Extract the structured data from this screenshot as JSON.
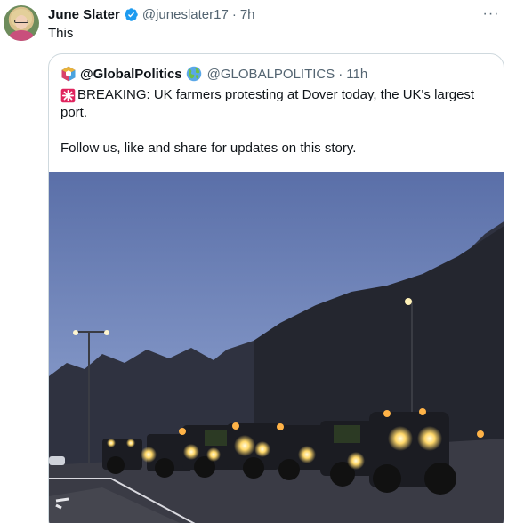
{
  "tweet": {
    "author_name": "June Slater",
    "handle": "@juneslater17",
    "separator": "·",
    "time": "7h",
    "text": "This",
    "more_label": "···"
  },
  "quote": {
    "author_name": "@GlobalPolitics",
    "handle": "@GLOBALPOLITICS",
    "separator": "·",
    "time": "11h",
    "breaking_text": "BREAKING: UK farmers protesting at Dover today, the UK's largest",
    "breaking_cont": "port.",
    "follow_text": "Follow us, like and share for updates on this story."
  },
  "colors": {
    "verified": "#1d9bf0",
    "muted": "#536471",
    "border": "#cfd9de",
    "siren": "#e0245e"
  },
  "icons": [
    "verified-badge-icon",
    "more-options-icon",
    "globe-icon",
    "siren-icon",
    "cube-logo-icon"
  ]
}
